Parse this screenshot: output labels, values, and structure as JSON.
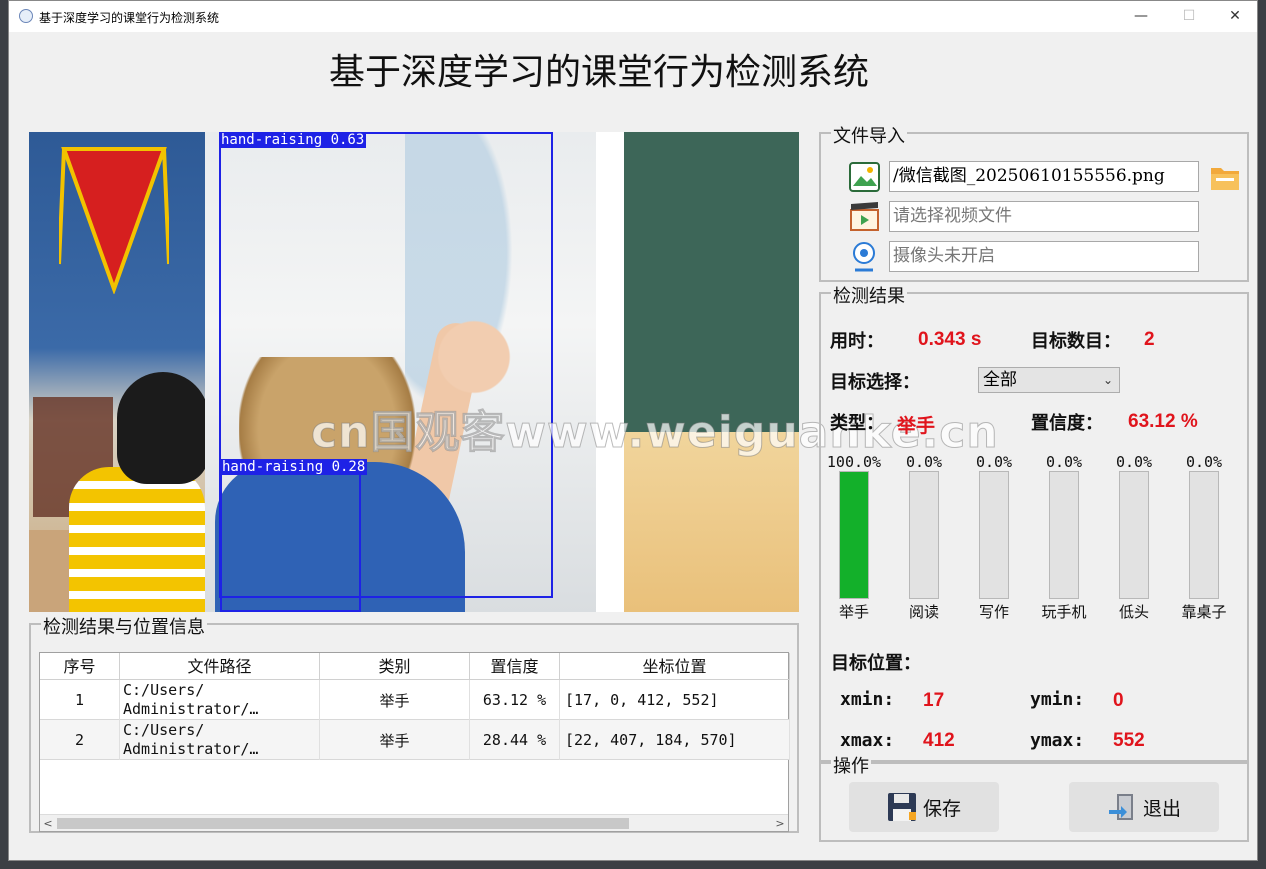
{
  "window": {
    "title": "基于深度学习的课堂行为检测系统",
    "minimize": "—",
    "maximize": "☐",
    "close": "✕"
  },
  "heading": "基于深度学习的课堂行为检测系统",
  "image": {
    "detections_overlay": [
      {
        "label": "hand-raising 0.63"
      },
      {
        "label": "hand-raising 0.28"
      }
    ],
    "watermark": "cn国观客www.weiguanke.cn"
  },
  "results_table": {
    "title": "检测结果与位置信息",
    "columns": [
      "序号",
      "文件路径",
      "类别",
      "置信度",
      "坐标位置"
    ],
    "rows": [
      {
        "index": "1",
        "path": "C:/Users/\nAdministrator/…",
        "category": "举手",
        "confidence": "63.12 %",
        "coords": "[17, 0, 412, 552]"
      },
      {
        "index": "2",
        "path": "C:/Users/\nAdministrator/…",
        "category": "举手",
        "confidence": "28.44 %",
        "coords": "[22, 407, 184, 570]"
      }
    ],
    "scroll_left": "<",
    "scroll_right": ">"
  },
  "file_import": {
    "title": "文件导入",
    "image_path": "/微信截图_20250610155556.png",
    "video_placeholder": "请选择视频文件",
    "camera_status": "摄像头未开启"
  },
  "detection": {
    "title": "检测结果",
    "time_label": "用时：",
    "time_value": "0.343 s",
    "count_label": "目标数目：",
    "count_value": "2",
    "select_label": "目标选择：",
    "select_value": "全部",
    "type_label": "类型：",
    "type_value": "举手",
    "conf_label": "置信度：",
    "conf_value": "63.12 %",
    "bars": [
      {
        "name": "举手",
        "pct_text": "100.0%",
        "fraction": 1.0
      },
      {
        "name": "阅读",
        "pct_text": "0.0%",
        "fraction": 0
      },
      {
        "name": "写作",
        "pct_text": "0.0%",
        "fraction": 0
      },
      {
        "name": "玩手机",
        "pct_text": "0.0%",
        "fraction": 0
      },
      {
        "name": "低头",
        "pct_text": "0.0%",
        "fraction": 0
      },
      {
        "name": "靠桌子",
        "pct_text": "0.0%",
        "fraction": 0
      }
    ],
    "bar_color": "#13b02a",
    "position_label": "目标位置：",
    "xmin_label": "xmin:",
    "xmin_value": "17",
    "ymin_label": "ymin:",
    "ymin_value": "0",
    "xmax_label": "xmax:",
    "xmax_value": "412",
    "ymax_label": "ymax:",
    "ymax_value": "552"
  },
  "operations": {
    "title": "操作",
    "save_label": "保存",
    "exit_label": "退出"
  },
  "accent_red": "#e0141c"
}
